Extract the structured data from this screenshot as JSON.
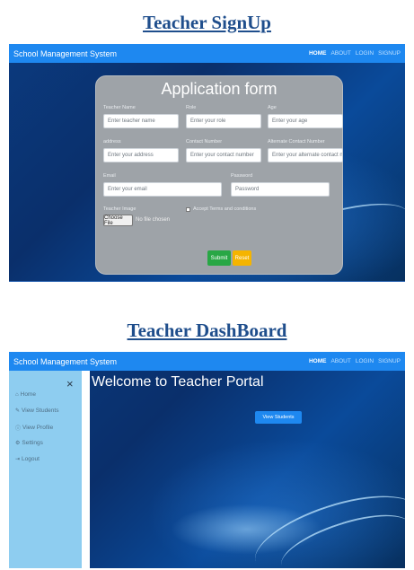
{
  "headings": {
    "signup": "Teacher SignUp",
    "dashboard": "Teacher DashBoard"
  },
  "navbar": {
    "brand": "School Management System",
    "links": [
      "HOME",
      "ABOUT",
      "LOGIN",
      "SIGNUP"
    ],
    "active": "HOME",
    "color": "#1e88f0"
  },
  "form": {
    "title": "Application form",
    "fields": {
      "teacher_name": {
        "label": "Teacher Name",
        "placeholder": "Enter teacher name"
      },
      "role": {
        "label": "Role",
        "placeholder": "Enter your role"
      },
      "age": {
        "label": "Age",
        "placeholder": "Enter your age"
      },
      "address": {
        "label": "address",
        "placeholder": "Enter your address"
      },
      "contact": {
        "label": "Contact Number",
        "placeholder": "Enter your contact number"
      },
      "alt_contact": {
        "label": "Alternate Contact Number",
        "placeholder": "Enter your alternate contact num"
      },
      "email": {
        "label": "Email",
        "placeholder": "Enter your email"
      },
      "password": {
        "label": "Password",
        "placeholder": "Password"
      },
      "image": {
        "label": "Teacher Image"
      }
    },
    "terms_label": "Accept Terms and conditions",
    "file_button": "Choose File",
    "file_status": "No file chosen",
    "submit": "Submit",
    "reset": "Reset",
    "submit_color": "#28a745",
    "reset_color": "#f5b400"
  },
  "dashboard": {
    "close_symbol": "×",
    "sidebar": [
      {
        "icon": "home-icon",
        "glyph": "⌂",
        "label": "Home"
      },
      {
        "icon": "pencil-icon",
        "glyph": "✎",
        "label": "View Students"
      },
      {
        "icon": "info-icon",
        "glyph": "ⓘ",
        "label": "View Profile"
      },
      {
        "icon": "gear-icon",
        "glyph": "⚙",
        "label": "Settings"
      },
      {
        "icon": "logout-icon",
        "glyph": "⇥",
        "label": "Logout"
      }
    ],
    "welcome": "Welcome to Teacher Portal",
    "view_students_button": "View Students",
    "sidebar_color": "#8ecdf0"
  }
}
